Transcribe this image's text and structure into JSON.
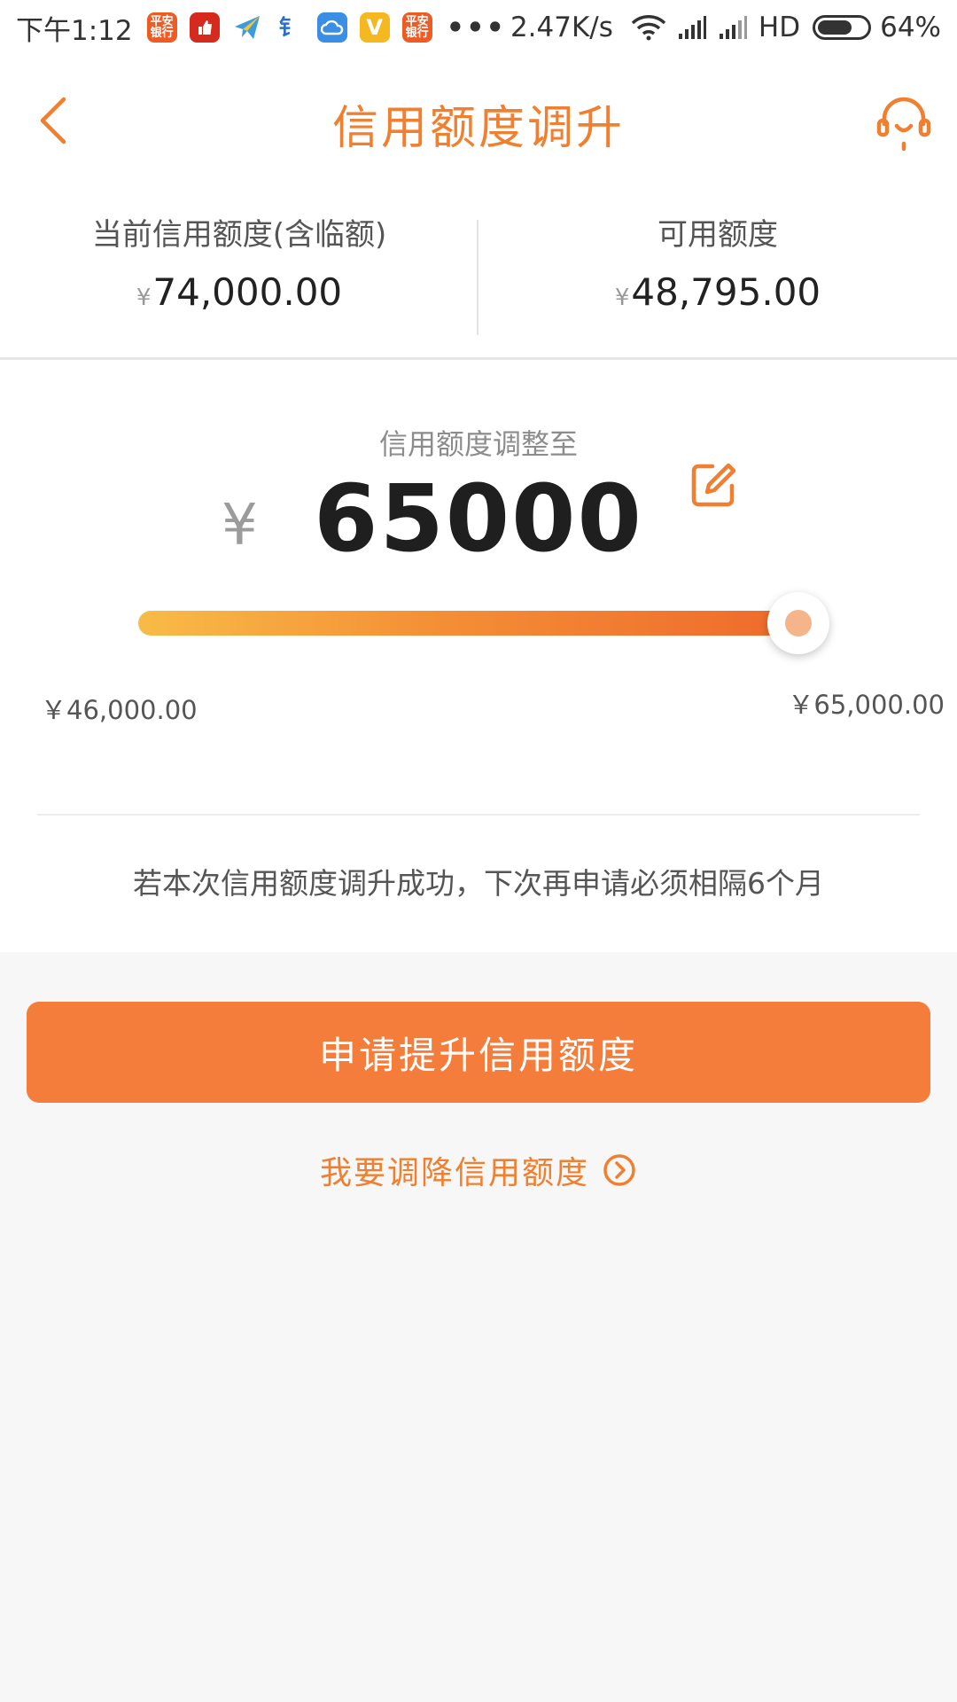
{
  "status_bar": {
    "time": "下午1:12",
    "app_icons": [
      {
        "name": "pingan-bank-icon",
        "text": "平安\n银行"
      },
      {
        "name": "thumb-app-icon",
        "text": ""
      },
      {
        "name": "paper-plane-icon",
        "text": ""
      },
      {
        "name": "huabei-icon",
        "text": "钅"
      },
      {
        "name": "cloud-app-icon",
        "text": ""
      },
      {
        "name": "vip-app-icon",
        "text": "V"
      },
      {
        "name": "pingan-bank-icon-2",
        "text": "平安\n银行"
      }
    ],
    "more": "•••",
    "net_speed": "2.47K/s",
    "hd": "HD",
    "battery": "64%"
  },
  "header": {
    "title": "信用额度调升"
  },
  "summary": {
    "current_label": "当前信用额度(含临额)",
    "current_currency": "¥",
    "current_value": "74,000.00",
    "available_label": "可用额度",
    "available_currency": "¥",
    "available_value": "48,795.00"
  },
  "adjust": {
    "label": "信用额度调整至",
    "currency": "¥",
    "amount": "65000",
    "slider": {
      "min": 46000,
      "max": 65000,
      "value": 65000
    },
    "min_label": "￥46,000.00",
    "max_label": "￥65,000.00",
    "notice": "若本次信用额度调升成功，下次再申请必须相隔6个月"
  },
  "actions": {
    "apply_label": "申请提升信用额度",
    "decrease_label": "我要调降信用额度"
  },
  "colors": {
    "accent": "#f07f2f",
    "button": "#f47d3c",
    "slider_start": "#f8bb47",
    "slider_end": "#ee6a2c"
  }
}
